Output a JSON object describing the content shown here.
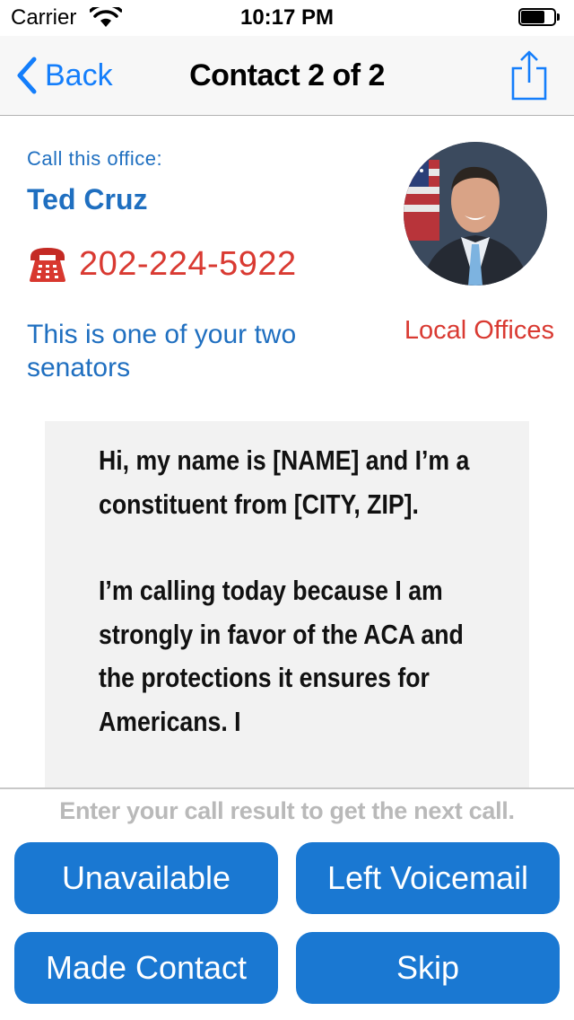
{
  "status_bar": {
    "carrier": "Carrier",
    "time": "10:17 PM",
    "battery_level": 0.75
  },
  "nav": {
    "back_label": "Back",
    "title": "Contact 2 of 2"
  },
  "contact": {
    "call_label": "Call this office:",
    "name": "Ted Cruz",
    "phone": "202-224-5922",
    "note": "This is one of your two senators",
    "local_offices_label": "Local Offices"
  },
  "script": {
    "paragraphs": [
      "Hi, my name is [NAME] and I’m a constituent from [CITY, ZIP].",
      "I’m calling today because I am strongly in favor of the ACA and the protections it ensures for Americans. I"
    ]
  },
  "footer": {
    "hint": "Enter your call result to get the next call.",
    "buttons": {
      "unavailable": "Unavailable",
      "voicemail": "Left Voicemail",
      "made_contact": "Made Contact",
      "skip": "Skip"
    }
  },
  "colors": {
    "accent_blue": "#1f6fc0",
    "button_blue": "#1a78d2",
    "phone_red": "#d93a32",
    "ios_blue": "#147efb"
  }
}
